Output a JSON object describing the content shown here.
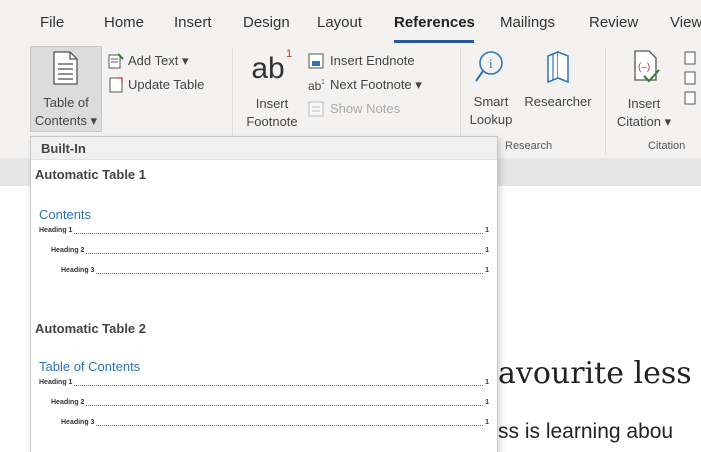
{
  "tabs": [
    "File",
    "Home",
    "Insert",
    "Design",
    "Layout",
    "References",
    "Mailings",
    "Review",
    "View"
  ],
  "active_tab": "References",
  "accent_color": "#2b579a",
  "ribbon": {
    "toc": {
      "line1": "Table of",
      "line2": "Contents ▾",
      "icon": "table-of-contents-icon"
    },
    "add_text": "Add Text ▾",
    "update_table": "Update Table",
    "insert_footnote": {
      "glyph": "ab",
      "superscript": "1",
      "line1": "Insert",
      "line2": "Footnote"
    },
    "insert_endnote": "Insert Endnote",
    "next_footnote": "Next Footnote ▾",
    "show_notes": "Show Notes",
    "smart_lookup": {
      "line1": "Smart",
      "line2": "Lookup"
    },
    "researcher": "Researcher",
    "research_group": "Research",
    "insert_citation": {
      "line1": "Insert",
      "line2": "Citation ▾"
    },
    "citations_group": "Citation"
  },
  "dropdown": {
    "header": "Built-In",
    "items": [
      {
        "name": "Automatic Table 1",
        "toc_title": "Contents",
        "entries": [
          {
            "label": "Heading 1",
            "page": "1"
          },
          {
            "label": "Heading 2",
            "page": "1"
          },
          {
            "label": "Heading 3",
            "page": "1"
          }
        ]
      },
      {
        "name": "Automatic Table 2",
        "toc_title": "Table of Contents",
        "entries": [
          {
            "label": "Heading 1",
            "page": "1"
          },
          {
            "label": "Heading 2",
            "page": "1"
          },
          {
            "label": "Heading 3",
            "page": "1"
          }
        ]
      }
    ]
  },
  "document": {
    "heading": "avourite less",
    "body": "ss is learning abou"
  }
}
